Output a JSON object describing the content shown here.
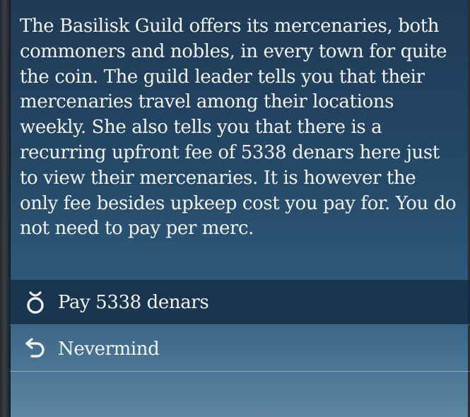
{
  "dialog": {
    "description": "The Basilisk Guild offers its mercenaries, both commoners and nobles, in every town for quite the coin. The guild leader tells you that their mercenaries travel among their locations weekly. She also tells you that there is a recurring upfront fee of 5338 denars here just to view their mercenaries. It is however the only fee besides upkeep cost you pay for. You do not need to pay per merc.",
    "options": [
      {
        "label": "Pay 5338 denars",
        "icon": "coin-pouch-icon",
        "selected": true
      },
      {
        "label": "Nevermind",
        "icon": "back-arrow-icon",
        "selected": false
      }
    ]
  },
  "colors": {
    "text": "#f2f2ee",
    "selected_row": "#122a42",
    "panel_top": "#1e3a56",
    "panel_bottom": "#5e86a2"
  }
}
